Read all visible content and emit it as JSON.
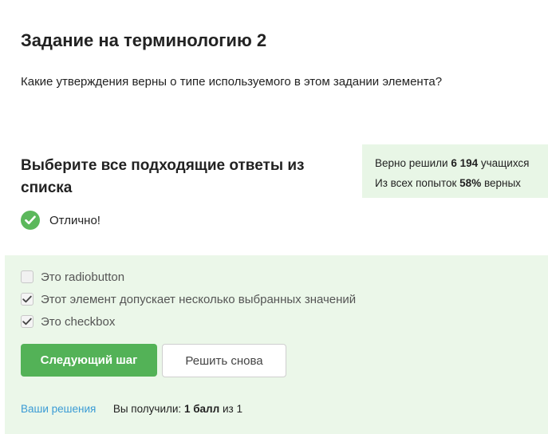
{
  "step": {
    "title": "Задание на терминологию 2",
    "question": "Какие утверждения верны о типе используемого в этом задании элемента?",
    "instruction": "Выберите все подходящие ответы из списка"
  },
  "stats": {
    "solved_prefix": "Верно решили",
    "solved_count": "6 194",
    "solved_suffix": "учащихся",
    "attempts_prefix": "Из всех попыток",
    "attempts_percent": "58%",
    "attempts_suffix": "верных"
  },
  "feedback": {
    "icon": "check-circle-icon",
    "text": "Отлично!",
    "color": "#5cb85c"
  },
  "options": [
    {
      "label": "Это radiobutton",
      "checked": false
    },
    {
      "label": "Этот элемент допускает несколько выбранных значений",
      "checked": true
    },
    {
      "label": "Это checkbox",
      "checked": true
    }
  ],
  "buttons": {
    "next_label": "Следующий шаг",
    "retry_label": "Решить снова"
  },
  "footer": {
    "solutions_link": "Ваши решения",
    "score_prefix": "Вы получили:",
    "score_value": "1 балл",
    "score_suffix": "из 1"
  },
  "colors": {
    "accent": "#53b257",
    "panel_bg": "#ebf7e9",
    "link": "#3a9bd5"
  }
}
